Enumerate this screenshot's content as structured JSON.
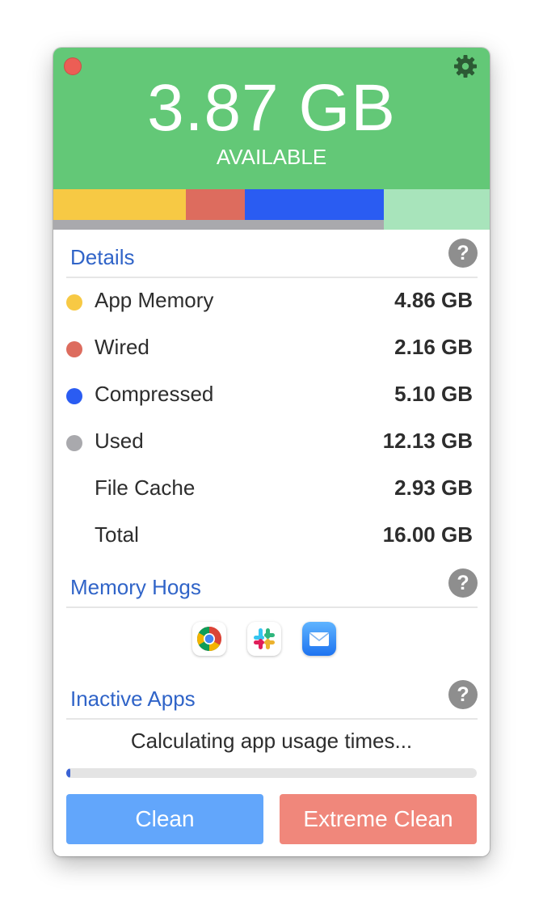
{
  "colors": {
    "header_bg": "#63c877",
    "app_memory": "#f7c944",
    "wired": "#dd6c5e",
    "compressed": "#2a5cf2",
    "used": "#a9a9ad",
    "free": "#a8e4bb",
    "clean_button": "#62a6fb",
    "extreme_clean_button": "#f0877b"
  },
  "header": {
    "available_value": "3.87 GB",
    "available_label": "AVAILABLE",
    "close_icon": "close-dot-icon",
    "settings_icon": "gear-icon"
  },
  "memory_bar": {
    "total_gb": 16.0,
    "app_memory_gb": 4.86,
    "wired_gb": 2.16,
    "compressed_gb": 5.1,
    "used_gb": 12.13
  },
  "details": {
    "title": "Details",
    "help_label": "?",
    "rows": [
      {
        "label": "App Memory",
        "value": "4.86 GB",
        "dot": "app_memory"
      },
      {
        "label": "Wired",
        "value": "2.16 GB",
        "dot": "wired"
      },
      {
        "label": "Compressed",
        "value": "5.10 GB",
        "dot": "compressed"
      },
      {
        "label": "Used",
        "value": "12.13 GB",
        "dot": "used"
      },
      {
        "label": "File Cache",
        "value": "2.93 GB",
        "dot": null
      },
      {
        "label": "Total",
        "value": "16.00 GB",
        "dot": null
      }
    ]
  },
  "memory_hogs": {
    "title": "Memory Hogs",
    "help_label": "?",
    "apps": [
      "chrome-icon",
      "slack-icon",
      "mail-icon"
    ]
  },
  "inactive_apps": {
    "title": "Inactive Apps",
    "help_label": "?",
    "status": "Calculating app usage times...",
    "progress": 0.01
  },
  "buttons": {
    "clean": "Clean",
    "extreme_clean": "Extreme Clean"
  }
}
